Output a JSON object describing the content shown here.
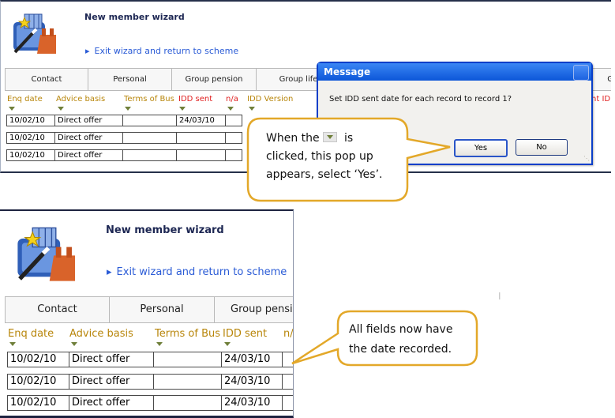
{
  "top": {
    "wizard_title": "New member wizard",
    "exit_link": "Exit wizard and return to scheme",
    "tabs": [
      "Contact",
      "Personal",
      "Group pension",
      "Group life",
      "G"
    ],
    "columns": [
      "Enq date",
      "Advice basis",
      "Terms of Bus",
      "IDD sent",
      "n/a",
      "IDD Version",
      "nt ID"
    ],
    "rows": [
      [
        "10/02/10",
        "Direct offer",
        "",
        "24/03/10",
        ""
      ],
      [
        "10/02/10",
        "Direct offer",
        "",
        "",
        ""
      ],
      [
        "10/02/10",
        "Direct offer",
        "",
        "",
        ""
      ]
    ]
  },
  "dialog": {
    "title": "Message",
    "message": "Set IDD sent date for each record to record 1?",
    "yes_label": "Yes",
    "no_label": "No"
  },
  "callout1": {
    "line1_before": "When the",
    "line1_after": "is",
    "line2": "clicked, this pop up",
    "line3": "appears, select ‘Yes’."
  },
  "bottom": {
    "wizard_title": "New member wizard",
    "exit_link": "Exit wizard and return to scheme",
    "tabs": [
      "Contact",
      "Personal",
      "Group pensio"
    ],
    "columns": [
      "Enq date",
      "Advice basis",
      "Terms of Bus",
      "IDD sent",
      "n/"
    ],
    "rows": [
      [
        "10/02/10",
        "Direct offer",
        "",
        "24/03/10",
        ""
      ],
      [
        "10/02/10",
        "Direct offer",
        "",
        "24/03/10",
        ""
      ],
      [
        "10/02/10",
        "Direct offer",
        "",
        "24/03/10",
        ""
      ]
    ]
  },
  "callout2": {
    "line1": "All fields now have",
    "line2": "the date recorded."
  },
  "colors": {
    "header_gold": "#b8860b",
    "header_red": "#e02020",
    "link_blue": "#2a5bd6",
    "callout_border": "#e3a829",
    "dialog_title_blue": "#0c56d8"
  },
  "icons": [
    "wizard-wand-icon",
    "arrow-right-icon",
    "dropdown-arrow-icon",
    "close-icon"
  ]
}
